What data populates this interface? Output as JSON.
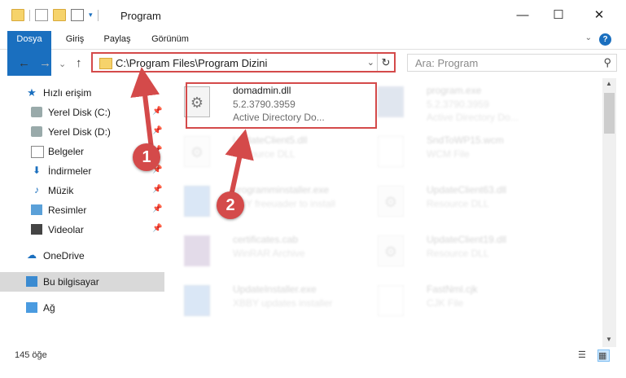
{
  "window": {
    "title": "Program",
    "minimize": "—",
    "maximize": "☐",
    "close": "✕"
  },
  "ribbon": {
    "tabs": [
      "Dosya",
      "Giriş",
      "Paylaş",
      "Görünüm"
    ],
    "help": "?",
    "expand": "⌄"
  },
  "nav": {
    "back": "←",
    "forward": "→",
    "dropdown": "⌄",
    "up": "↑"
  },
  "address": {
    "path": "C:\\Program Files\\Program Dizini",
    "dropdown": "⌄",
    "refresh": "↻"
  },
  "search": {
    "placeholder": "Ara: Program",
    "icon": "⚲"
  },
  "sidebar": {
    "items": [
      {
        "label": "Hızlı erişim",
        "icon": "star-icon",
        "pinned": false
      },
      {
        "label": "Yerel Disk (C:)",
        "icon": "drive-icon",
        "pinned": true
      },
      {
        "label": "Yerel Disk (D:)",
        "icon": "drive-icon",
        "pinned": true
      },
      {
        "label": "Belgeler",
        "icon": "documents-icon",
        "pinned": true
      },
      {
        "label": "İndirmeler",
        "icon": "download-icon",
        "pinned": true
      },
      {
        "label": "Müzik",
        "icon": "music-icon",
        "pinned": true
      },
      {
        "label": "Resimler",
        "icon": "pictures-icon",
        "pinned": true
      },
      {
        "label": "Videolar",
        "icon": "videos-icon",
        "pinned": true
      },
      {
        "label": "OneDrive",
        "icon": "cloud-icon",
        "pinned": false
      },
      {
        "label": "Bu bilgisayar",
        "icon": "computer-icon",
        "pinned": false
      },
      {
        "label": "Ağ",
        "icon": "network-icon",
        "pinned": false
      }
    ],
    "pin_glyph": "📌"
  },
  "files": [
    {
      "name": "domadmin.dll",
      "line2": "5.2.3790.3959",
      "line3": "Active Directory Do...",
      "icon": "dll-gear-icon",
      "faded": false
    },
    {
      "name": "program.exe",
      "line2": "5.2.3790.3959",
      "line3": "Active Directory Do...",
      "icon": "exe-icon",
      "faded": true
    },
    {
      "name": "UpdateClient5.dll",
      "line2": "Resource DLL",
      "line3": "",
      "icon": "dll-gear-icon",
      "faded": true
    },
    {
      "name": "SndToWP15.wcm",
      "line2": "WCM File",
      "line3": "",
      "icon": "blank-file-icon",
      "faded": true
    },
    {
      "name": "programminstaller.exe",
      "line2": "XBY freeuader to install",
      "line3": "",
      "icon": "installer-icon",
      "faded": true
    },
    {
      "name": "UpdateClient63.dll",
      "line2": "Resource DLL",
      "line3": "",
      "icon": "dll-gear-icon",
      "faded": true
    },
    {
      "name": "certificates.cab",
      "line2": "WinRAR Archive",
      "line3": "",
      "icon": "winrar-icon",
      "faded": true
    },
    {
      "name": "UpdateClient19.dll",
      "line2": "Resource DLL",
      "line3": "",
      "icon": "dll-gear-icon",
      "faded": true
    },
    {
      "name": "UpdateInstaller.exe",
      "line2": "XBBY updates installer",
      "line3": "",
      "icon": "installer-icon",
      "faded": true
    },
    {
      "name": "FastNml.cjk",
      "line2": "CJK File",
      "line3": "",
      "icon": "blank-file-icon",
      "faded": true
    }
  ],
  "status": {
    "count": "145 öğe"
  },
  "callouts": {
    "one": "1",
    "two": "2"
  },
  "colors": {
    "accent": "#1a6fbf",
    "highlight": "#d44a4a",
    "selected": "#d9d9d9"
  }
}
